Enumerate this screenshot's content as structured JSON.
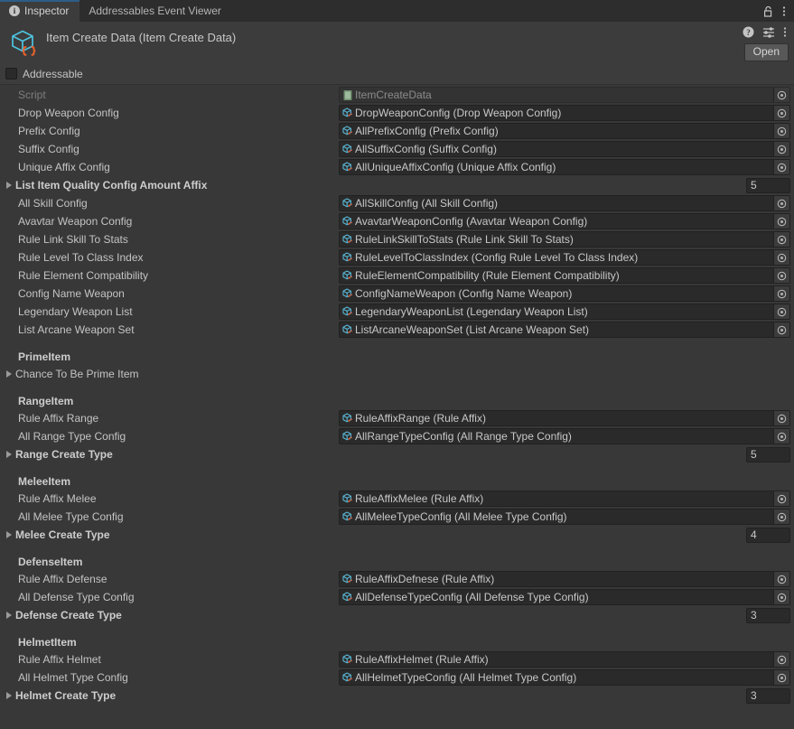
{
  "window": {
    "tabs": [
      {
        "label": "Inspector",
        "icon": "info-icon",
        "active": true
      },
      {
        "label": "Addressables Event Viewer",
        "icon": null,
        "active": false
      }
    ],
    "titlebar_icons": [
      "lock-icon",
      "kebab-menu-icon"
    ]
  },
  "asset": {
    "title": "Item Create Data (Item Create Data)",
    "icon": "scriptable-object-cube-icon",
    "header_icons": [
      "help-icon",
      "preset-icon",
      "kebab-menu-icon"
    ],
    "open_button": "Open"
  },
  "addressable": {
    "label": "Addressable",
    "checked": false
  },
  "rows": [
    {
      "type": "object",
      "label": "Script",
      "value": "ItemCreateData",
      "icon": "cs-script-icon",
      "disabled": true
    },
    {
      "type": "object",
      "label": "Drop Weapon Config",
      "value": "DropWeaponConfig (Drop Weapon Config)",
      "icon": "scriptable-object-icon"
    },
    {
      "type": "object",
      "label": "Prefix Config",
      "value": "AllPrefixConfig (Prefix Config)",
      "icon": "scriptable-object-icon"
    },
    {
      "type": "object",
      "label": "Suffix Config",
      "value": "AllSuffixConfig (Suffix Config)",
      "icon": "scriptable-object-icon"
    },
    {
      "type": "object",
      "label": "Unique Affix Config",
      "value": "AllUniqueAffixConfig (Unique Affix Config)",
      "icon": "scriptable-object-icon"
    },
    {
      "type": "foldout-number",
      "label": "List Item Quality Config Amount Affix",
      "value": "5"
    },
    {
      "type": "object",
      "label": "All Skill Config",
      "value": "AllSkillConfig (All Skill Config)",
      "icon": "scriptable-object-icon"
    },
    {
      "type": "object",
      "label": "Avavtar Weapon Config",
      "value": "AvavtarWeaponConfig (Avavtar Weapon Config)",
      "icon": "scriptable-object-icon"
    },
    {
      "type": "object",
      "label": "Rule Link Skill To Stats",
      "value": "RuleLinkSkillToStats (Rule Link Skill To Stats)",
      "icon": "scriptable-object-icon"
    },
    {
      "type": "object",
      "label": "Rule Level To Class Index",
      "value": "RuleLevelToClassIndex (Config Rule Level To Class Index)",
      "icon": "scriptable-object-icon"
    },
    {
      "type": "object",
      "label": "Rule Element Compatibility",
      "value": "RuleElementCompatibility (Rule Element Compatibility)",
      "icon": "scriptable-object-icon"
    },
    {
      "type": "object",
      "label": "Config Name Weapon",
      "value": "ConfigNameWeapon (Config Name Weapon)",
      "icon": "scriptable-object-icon"
    },
    {
      "type": "object",
      "label": "Legendary Weapon List",
      "value": "LegendaryWeaponList (Legendary Weapon List)",
      "icon": "scriptable-object-icon"
    },
    {
      "type": "object",
      "label": "List Arcane Weapon Set",
      "value": "ListArcaneWeaponSet (List Arcane Weapon Set)",
      "icon": "scriptable-object-icon"
    },
    {
      "type": "spacer"
    },
    {
      "type": "header",
      "label": "PrimeItem"
    },
    {
      "type": "foldout",
      "label": "Chance To Be Prime Item"
    },
    {
      "type": "spacer"
    },
    {
      "type": "header",
      "label": "RangeItem"
    },
    {
      "type": "object",
      "label": "Rule Affix Range",
      "value": "RuleAffixRange (Rule Affix)",
      "icon": "scriptable-object-icon"
    },
    {
      "type": "object",
      "label": "All Range Type Config",
      "value": "AllRangeTypeConfig (All Range Type Config)",
      "icon": "scriptable-object-icon"
    },
    {
      "type": "foldout-number",
      "label": "Range Create Type",
      "value": "5"
    },
    {
      "type": "spacer"
    },
    {
      "type": "header",
      "label": "MeleeItem"
    },
    {
      "type": "object",
      "label": "Rule Affix Melee",
      "value": "RuleAffixMelee (Rule Affix)",
      "icon": "scriptable-object-icon"
    },
    {
      "type": "object",
      "label": "All Melee Type Config",
      "value": "AllMeleeTypeConfig (All Melee Type Config)",
      "icon": "scriptable-object-icon"
    },
    {
      "type": "foldout-number",
      "label": "Melee Create Type",
      "value": "4"
    },
    {
      "type": "spacer"
    },
    {
      "type": "header",
      "label": "DefenseItem"
    },
    {
      "type": "object",
      "label": "Rule Affix Defense",
      "value": "RuleAffixDefnese (Rule Affix)",
      "icon": "scriptable-object-icon"
    },
    {
      "type": "object",
      "label": "All Defense Type Config",
      "value": "AllDefenseTypeConfig (All Defense Type Config)",
      "icon": "scriptable-object-icon"
    },
    {
      "type": "foldout-number",
      "label": "Defense Create Type",
      "value": "3"
    },
    {
      "type": "spacer"
    },
    {
      "type": "header",
      "label": "HelmetItem"
    },
    {
      "type": "object",
      "label": "Rule Affix Helmet",
      "value": "RuleAffixHelmet (Rule Affix)",
      "icon": "scriptable-object-icon"
    },
    {
      "type": "object",
      "label": "All Helmet Type Config",
      "value": "AllHelmetTypeConfig (All Helmet Type Config)",
      "icon": "scriptable-object-icon"
    },
    {
      "type": "foldout-number",
      "label": "Helmet Create Type",
      "value": "3"
    }
  ],
  "colors": {
    "background": "#383838",
    "panel": "#3c3c3c",
    "field": "#2a2a2a",
    "accent": "#2c5d87",
    "icon_cyan": "#4ec3e0",
    "icon_orange": "#e8622d",
    "text": "#c4c4c4"
  }
}
